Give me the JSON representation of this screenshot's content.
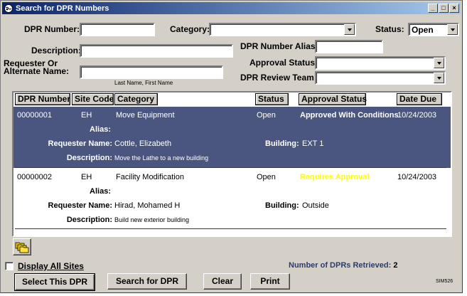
{
  "window": {
    "title": "Search for DPR Numbers"
  },
  "form": {
    "dpr_number_label": "DPR Number:",
    "dpr_number_value": "",
    "category_label": "Category:",
    "category_value": "",
    "status_label": "Status:",
    "status_value": "Open",
    "description_label": "Description:",
    "description_value": "",
    "alias_label": "DPR Number Alias:",
    "alias_value": "",
    "approval_status_label": "Approval Status:",
    "approval_status_value": "",
    "requester_label_1": "Requester Or",
    "requester_label_2": "Alternate Name:",
    "requester_value": "",
    "requester_hint": "Last Name, First Name",
    "review_team_label": "DPR Review Team:",
    "review_team_value": ""
  },
  "grid": {
    "columns": [
      "DPR Number",
      "Site Code",
      "Category",
      "Status",
      "Approval Status",
      "Date Due"
    ],
    "alias_label": "Alias:",
    "requester_label": "Requester Name:",
    "description_label": "Description:",
    "building_label": "Building:",
    "rows": [
      {
        "dpr_number": "00000001",
        "site_code": "EH",
        "category": "Move Equipment",
        "status": "Open",
        "approval_status": "Approved With Conditions",
        "date_due": "10/24/2003",
        "alias": "",
        "requester": "Cottle, Elizabeth",
        "building": "EXT 1",
        "description": "Move the Lathe to a new building"
      },
      {
        "dpr_number": "00000002",
        "site_code": "EH",
        "category": "Facility Modification",
        "status": "Open",
        "approval_status": "Requires Approval",
        "date_due": "10/24/2003",
        "alias": "",
        "requester": "Hirad, Mohamed H",
        "building": "Outside",
        "description": "Build new exterior building"
      }
    ]
  },
  "footer": {
    "display_all_sites": "Display All Sites",
    "retrieved_label": "Number of DPRs Retrieved:",
    "retrieved_count": "2",
    "select_button": "Select This DPR",
    "search_button": "Search for DPR",
    "clear_button": "Clear",
    "print_button": "Print",
    "code": "SIM526"
  },
  "colors": {
    "selected_row": "#4a5680",
    "approved_text": "#ffffff",
    "requires_approval_text": "#ffff00",
    "retrieved_label": "#2e3a6e"
  },
  "icons": {
    "app": "app-globe-icon",
    "toolbar": "folders-icon"
  }
}
